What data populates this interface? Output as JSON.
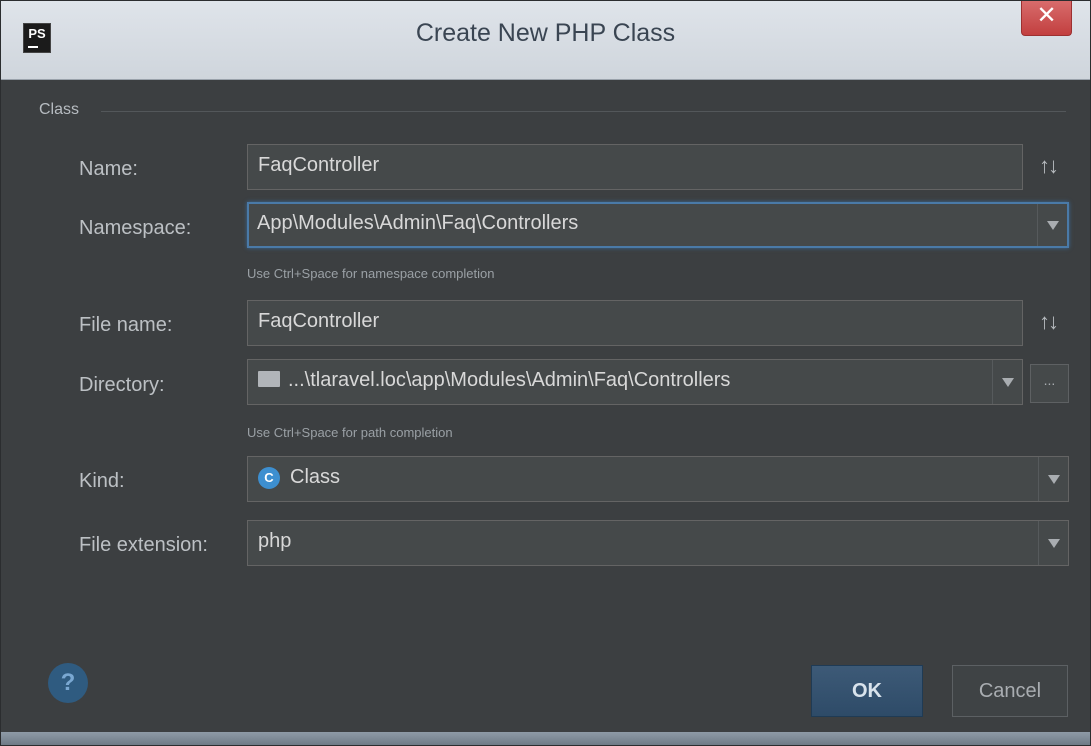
{
  "window": {
    "title": "Create New PHP Class",
    "app_logo": "PS",
    "close_label": "✕"
  },
  "section": {
    "label": "Class"
  },
  "fields": {
    "name": {
      "label": "Name:",
      "value": "FaqController"
    },
    "namespace": {
      "label": "Namespace:",
      "value": "App\\Modules\\Admin\\Faq\\Controllers",
      "hint": "Use Ctrl+Space for namespace completion"
    },
    "file_name": {
      "label": "File name:",
      "value": "FaqController"
    },
    "directory": {
      "label": "Directory:",
      "value": "...\\tlaravel.loc\\app\\Modules\\Admin\\Faq\\Controllers",
      "hint": "Use Ctrl+Space for path completion",
      "browse_label": "..."
    },
    "kind": {
      "label": "Kind:",
      "value": "Class",
      "icon_letter": "C"
    },
    "file_extension": {
      "label": "File extension:",
      "value": "php"
    }
  },
  "sort_icon": "↑↓",
  "buttons": {
    "ok": "OK",
    "cancel": "Cancel",
    "help": "?"
  },
  "colors": {
    "accent": "#4a7aa8",
    "background": "#3c3f41",
    "close": "#c94a4a"
  }
}
